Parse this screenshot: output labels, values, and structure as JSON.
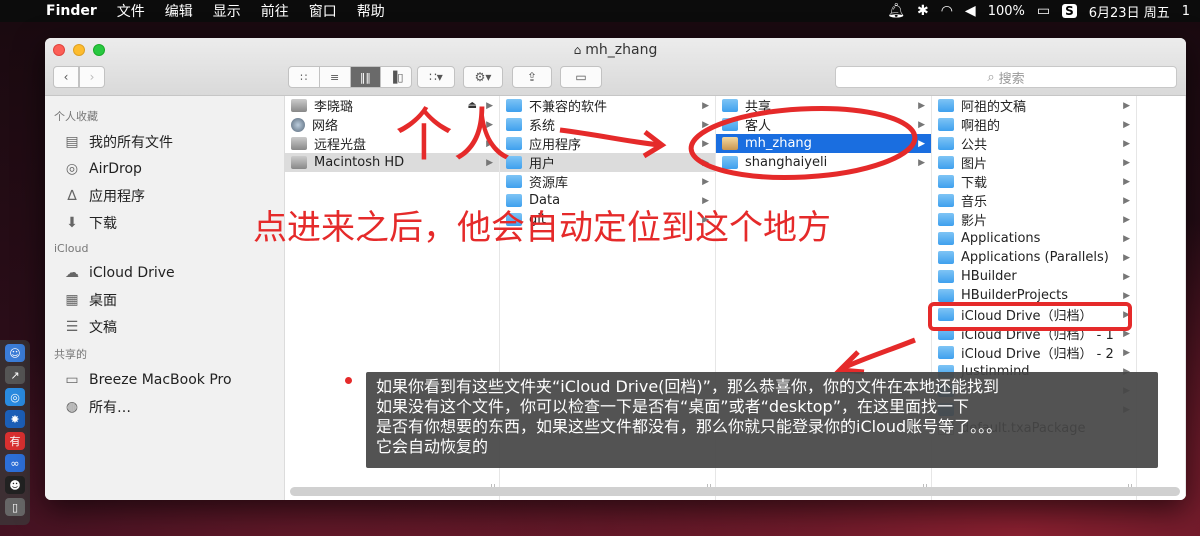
{
  "menubar": {
    "app": "Finder",
    "items": [
      "文件",
      "编辑",
      "显示",
      "前往",
      "窗口",
      "帮助"
    ],
    "battery": "100%",
    "date": "6月23日 周五",
    "time": "1"
  },
  "window": {
    "title": "mh_zhang",
    "search_placeholder": "搜索"
  },
  "sidebar": {
    "sections": [
      {
        "header": "个人收藏",
        "items": [
          {
            "label": "我的所有文件",
            "icon": "all-files-icon"
          },
          {
            "label": "AirDrop",
            "icon": "airdrop-icon"
          },
          {
            "label": "应用程序",
            "icon": "applications-icon"
          },
          {
            "label": "下载",
            "icon": "download-icon"
          }
        ]
      },
      {
        "header": "iCloud",
        "items": [
          {
            "label": "iCloud Drive",
            "icon": "cloud-icon"
          },
          {
            "label": "桌面",
            "icon": "desktop-icon"
          },
          {
            "label": "文稿",
            "icon": "documents-icon"
          }
        ]
      },
      {
        "header": "共享的",
        "items": [
          {
            "label": "Breeze MacBook Pro",
            "icon": "computer-icon"
          },
          {
            "label": "所有…",
            "icon": "network-icon"
          }
        ]
      }
    ]
  },
  "columns": [
    {
      "rows": [
        {
          "label": "李晓璐",
          "icon": "disk-icon",
          "eject": true
        },
        {
          "label": "网络",
          "icon": "globe-icon"
        },
        {
          "label": "远程光盘",
          "icon": "disc-icon"
        },
        {
          "label": "Macintosh HD",
          "icon": "hard-drive-icon",
          "selected": "gray"
        }
      ]
    },
    {
      "rows": [
        {
          "label": "不兼容的软件",
          "icon": "folder-icon"
        },
        {
          "label": "系统",
          "icon": "folder-icon"
        },
        {
          "label": "应用程序",
          "icon": "folder-icon"
        },
        {
          "label": "用户",
          "icon": "folder-icon",
          "selected": "gray"
        },
        {
          "label": "资源库",
          "icon": "folder-icon"
        },
        {
          "label": "Data",
          "icon": "folder-icon"
        },
        {
          "label": "git",
          "icon": "folder-icon"
        }
      ]
    },
    {
      "rows": [
        {
          "label": "共享",
          "icon": "folder-icon"
        },
        {
          "label": "客人",
          "icon": "folder-icon"
        },
        {
          "label": "mh_zhang",
          "icon": "home-folder-icon",
          "selected": "blue"
        },
        {
          "label": "shanghaiyeli",
          "icon": "folder-icon"
        }
      ]
    },
    {
      "rows": [
        {
          "label": "阿祖的文稿",
          "icon": "folder-icon"
        },
        {
          "label": "啊祖的",
          "icon": "folder-icon"
        },
        {
          "label": "公共",
          "icon": "folder-icon"
        },
        {
          "label": "图片",
          "icon": "folder-icon"
        },
        {
          "label": "下载",
          "icon": "folder-icon"
        },
        {
          "label": "音乐",
          "icon": "folder-icon"
        },
        {
          "label": "影片",
          "icon": "folder-icon"
        },
        {
          "label": "Applications",
          "icon": "folder-icon"
        },
        {
          "label": "Applications (Parallels)",
          "icon": "folder-icon"
        },
        {
          "label": "HBuilder",
          "icon": "folder-icon"
        },
        {
          "label": "HBuilderProjects",
          "icon": "folder-icon"
        },
        {
          "label": "iCloud Drive（归档）",
          "icon": "folder-icon"
        },
        {
          "label": "iCloud Drive（归档） - 1",
          "icon": "folder-icon"
        },
        {
          "label": "iCloud Drive（归档） - 2",
          "icon": "folder-icon"
        },
        {
          "label": "Justinmind",
          "icon": "folder-icon"
        },
        {
          "label": "",
          "icon": "folder-icon"
        },
        {
          "label": "",
          "icon": "folder-icon"
        },
        {
          "label": "default.txaPackage",
          "icon": "document-icon"
        }
      ]
    }
  ],
  "annotations": {
    "geren": "个人",
    "main_note": "点进来之后，他会自动定位到这个地方",
    "tooltip_lines": [
      "如果你看到有这些文件夹“iCloud Drive(回档)”，那么恭喜你，你的文件在本地还能找到",
      "如果没有这个文件，你可以检查一下是否有“桌面”或者“desktop”，在这里面找一下",
      "是否有你想要的东西，如果这些文件都没有，那么你就只能登录你的iCloud账号等了。。。",
      "它会自动恢复的"
    ],
    "color": "#e52a2a"
  }
}
